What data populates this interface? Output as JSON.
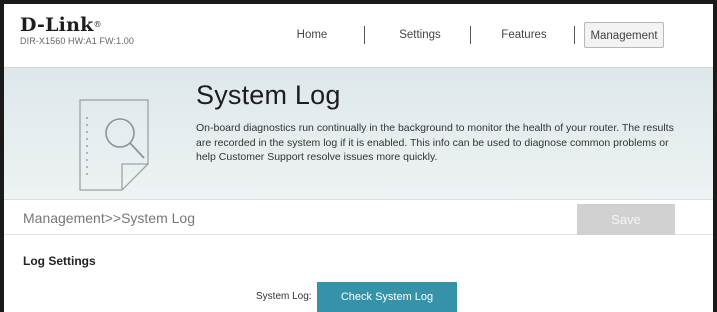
{
  "brand": {
    "name": "D-Link",
    "trademark": "®",
    "model_info": "DIR-X1560 HW:A1 FW:1.00"
  },
  "nav": {
    "items": [
      "Home",
      "Settings",
      "Features",
      "Management"
    ],
    "active": "Management"
  },
  "banner": {
    "title": "System Log",
    "description": "On-board diagnostics run continually in the background to monitor the health of your router. The results are recorded in the system log if it is enabled. This info can be used to diagnose common problems or help Customer Support resolve issues more quickly."
  },
  "breadcrumb": "Management>>System Log",
  "toolbar": {
    "save_label": "Save"
  },
  "log_settings": {
    "section_title": "Log Settings",
    "system_log_label": "System Log:",
    "check_button_label": "Check System Log"
  },
  "colors": {
    "accent": "#3592a8",
    "save_disabled": "#d1d1d1",
    "banner_bg": "#e5edef"
  }
}
